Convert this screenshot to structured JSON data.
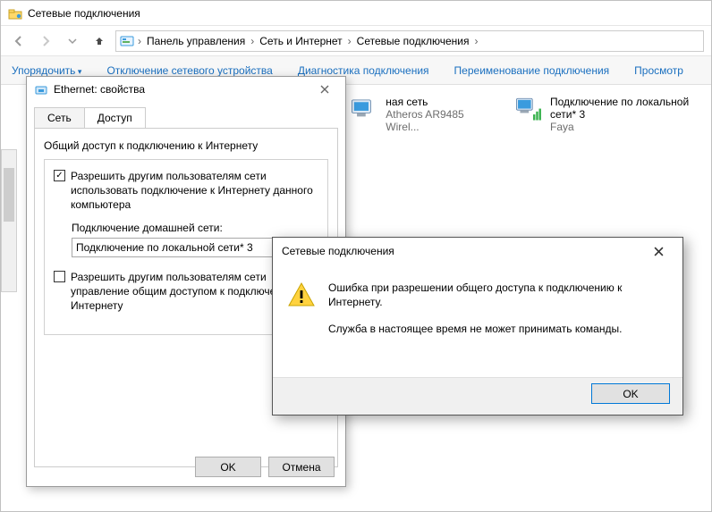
{
  "window": {
    "title": "Сетевые подключения"
  },
  "breadcrumb": {
    "items": [
      "Панель управления",
      "Сеть и Интернет",
      "Сетевые подключения"
    ]
  },
  "toolbar": {
    "organize": "Упорядочить",
    "disable": "Отключение сетевого устройства",
    "diagnose": "Диагностика подключения",
    "rename": "Переименование подключения",
    "view": "Просмотр"
  },
  "connections": [
    {
      "name": "ная сеть",
      "line2": "",
      "line3": "Atheros AR9485 Wirel..."
    },
    {
      "name": "Подключение по локальной сети* 3",
      "line2": "",
      "line3": "Faya"
    }
  ],
  "props": {
    "title": "Ethernet: свойства",
    "tabs": {
      "network": "Сеть",
      "access": "Доступ"
    },
    "group_label": "Общий доступ к подключению к Интернету",
    "chk1": "Разрешить другим пользователям сети использовать подключение к Интернету данного компьютера",
    "home_net_label": "Подключение домашней сети:",
    "combo_value": "Подключение по локальной сети* 3",
    "chk2": "Разрешить другим пользователям сети управление общим доступом к подключению к Интернету",
    "ok": "OK",
    "cancel": "Отмена"
  },
  "msg": {
    "title": "Сетевые подключения",
    "line1": "Ошибка при разрешении общего доступа к подключению к Интернету.",
    "line2": "Служба в настоящее время не может принимать команды.",
    "ok": "OK"
  }
}
